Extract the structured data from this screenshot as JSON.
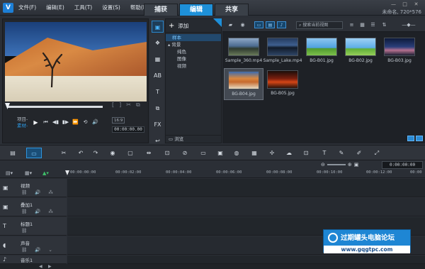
{
  "titlebar": {
    "menu": [
      "文件(F)",
      "编辑(E)",
      "工具(T)",
      "设置(S)",
      "帮助(H)"
    ],
    "mode_tabs": [
      "捕获",
      "编辑",
      "共享"
    ],
    "active_tab": "编辑",
    "project_info": "未命名, 720*576",
    "window_controls": [
      "—",
      "□",
      "✕"
    ]
  },
  "preview": {
    "mode_labels": [
      "项目-",
      "素材-"
    ],
    "transport": [
      "⏮",
      "▶",
      "⏪",
      "◀▮",
      "▮▶",
      "⏩",
      "⟲",
      "🔊"
    ],
    "aspect_chip": "16:9",
    "timecode": "00:00:00.00"
  },
  "library": {
    "add_label": "添加",
    "tree": {
      "selected": "样本",
      "parent": "背景",
      "children": [
        "纯色",
        "图像",
        "视频"
      ]
    },
    "browse_label": "浏览",
    "search_placeholder": "搜索当前视图",
    "tool_icons": [
      "▣",
      "❖",
      "▦",
      "AB",
      "T",
      "⧉",
      "FX",
      "↩"
    ],
    "thumbnails": [
      {
        "name": "Sample_360.mp4"
      },
      {
        "name": "Sample_Lake.mp4"
      },
      {
        "name": "BG-B01.jpg"
      },
      {
        "name": "BG-B02.jpg"
      },
      {
        "name": "BG-B03.jpg"
      },
      {
        "name": "BG-B04.jpg"
      },
      {
        "name": "BG-B05.jpg"
      }
    ],
    "selected_thumbnail": "BG-B04.jpg"
  },
  "timeline": {
    "zoom": {
      "minus": "⊖",
      "plus": "⊕"
    },
    "time_display": "0:00:00:00",
    "ruler_ticks": [
      "00:00:00:00",
      "00:00:02:00",
      "00:00:04:00",
      "00:00:06:00",
      "00:00:08:00",
      "00:00:10:00",
      "00:00:12:00",
      "00:00"
    ],
    "tracks": [
      {
        "name": "视频",
        "icon": "▣"
      },
      {
        "name": "叠加1",
        "icon": "▣"
      },
      {
        "name": "标题1",
        "icon": "T"
      },
      {
        "name": "声音",
        "icon": "◖"
      },
      {
        "name": "音乐1",
        "icon": "♪"
      }
    ]
  },
  "watermark": {
    "title": "过期罐头电脑论坛",
    "url": "www.gqgtpc.com"
  },
  "colors": {
    "accent": "#1e90d8",
    "background": "#2b2f36"
  }
}
